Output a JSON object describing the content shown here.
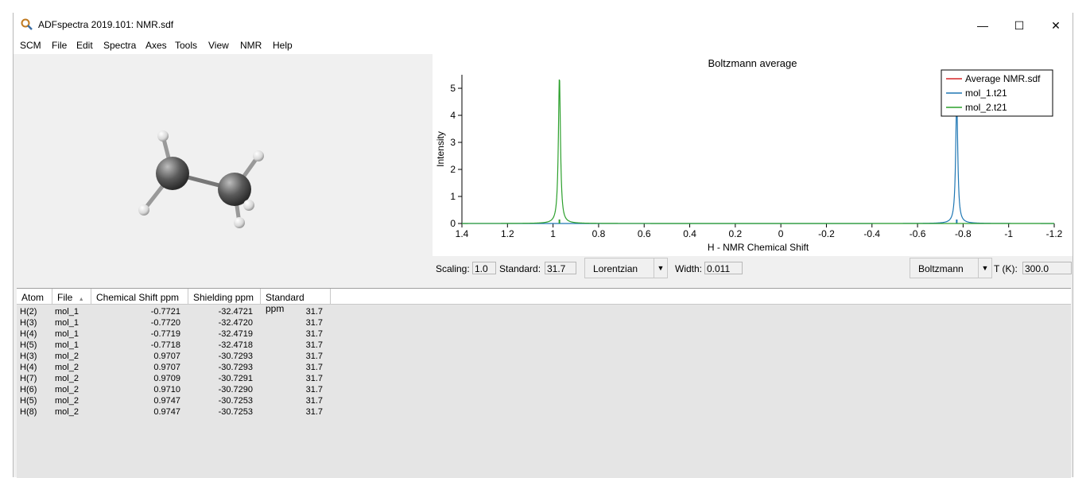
{
  "window": {
    "title": "ADFspectra 2019.101: NMR.sdf",
    "minimize_glyph": "—",
    "maximize_glyph": "☐",
    "close_glyph": "✕"
  },
  "menu": [
    {
      "label": "SCM",
      "mnemonic": "S"
    },
    {
      "label": "File",
      "mnemonic": "F"
    },
    {
      "label": "Edit",
      "mnemonic": "E"
    },
    {
      "label": "Spectra",
      "mnemonic": "S"
    },
    {
      "label": "Axes",
      "mnemonic": "A"
    },
    {
      "label": "Tools",
      "mnemonic": "T"
    },
    {
      "label": "View",
      "mnemonic": "V"
    },
    {
      "label": "NMR",
      "mnemonic": "N"
    },
    {
      "label": "Help",
      "mnemonic": "H"
    }
  ],
  "controls": {
    "scaling_label": "Scaling:",
    "scaling_value": "1.0",
    "standard_label": "Standard:",
    "standard_value": "31.7",
    "lineshape": "Lorentzian",
    "width_label": "Width:",
    "width_value": "0.011",
    "averaging": "Boltzmann",
    "temp_label": "T (K):",
    "temp_value": "300.0"
  },
  "table": {
    "columns": [
      "Atom",
      "File",
      "Chemical Shift ppm",
      "Shielding ppm",
      "Standard ppm"
    ],
    "sort_indicator": "▲",
    "rows": [
      [
        "H(2)",
        "mol_1",
        "-0.7721",
        "-32.4721",
        "31.7"
      ],
      [
        "H(3)",
        "mol_1",
        "-0.7720",
        "-32.4720",
        "31.7"
      ],
      [
        "H(4)",
        "mol_1",
        "-0.7719",
        "-32.4719",
        "31.7"
      ],
      [
        "H(5)",
        "mol_1",
        "-0.7718",
        "-32.4718",
        "31.7"
      ],
      [
        "H(3)",
        "mol_2",
        "0.9707",
        "-30.7293",
        "31.7"
      ],
      [
        "H(4)",
        "mol_2",
        "0.9707",
        "-30.7293",
        "31.7"
      ],
      [
        "H(7)",
        "mol_2",
        "0.9709",
        "-30.7291",
        "31.7"
      ],
      [
        "H(6)",
        "mol_2",
        "0.9710",
        "-30.7290",
        "31.7"
      ],
      [
        "H(5)",
        "mol_2",
        "0.9747",
        "-30.7253",
        "31.7"
      ],
      [
        "H(8)",
        "mol_2",
        "0.9747",
        "-30.7253",
        "31.7"
      ]
    ]
  },
  "chart_data": {
    "type": "line",
    "title": "Boltzmann average",
    "xlabel": "H - NMR Chemical Shift",
    "ylabel": "Intensity",
    "xlim": [
      1.4,
      -1.2
    ],
    "ylim": [
      0,
      5.5
    ],
    "xticks": [
      1.4,
      1.2,
      1,
      0.8,
      0.6,
      0.4,
      0.2,
      0,
      -0.2,
      -0.4,
      -0.6,
      -0.8,
      -1,
      -1.2
    ],
    "xtick_labels": [
      "1.4",
      "1.2",
      "1",
      "0.8",
      "0.6",
      "0.4",
      "0.2",
      "0",
      "-0.2",
      "-0.4",
      "-0.6",
      "-0.8",
      "-1",
      "-1.2"
    ],
    "yticks": [
      0,
      1,
      2,
      3,
      4,
      5
    ],
    "ytick_labels": [
      "0",
      "1",
      "2",
      "3",
      "4",
      "5"
    ],
    "lineshape": "Lorentzian",
    "width": 0.011,
    "legend_position": "top-right",
    "series": [
      {
        "name": "Average NMR.sdf",
        "color": "#d62728",
        "peaks": []
      },
      {
        "name": "mol_1.t21",
        "color": "#1f77b4",
        "peaks": [
          {
            "x": -0.772,
            "y": 4.6
          }
        ]
      },
      {
        "name": "mol_2.t21",
        "color": "#2ca02c",
        "peaks": [
          {
            "x": 0.972,
            "y": 5.45
          }
        ]
      }
    ]
  }
}
